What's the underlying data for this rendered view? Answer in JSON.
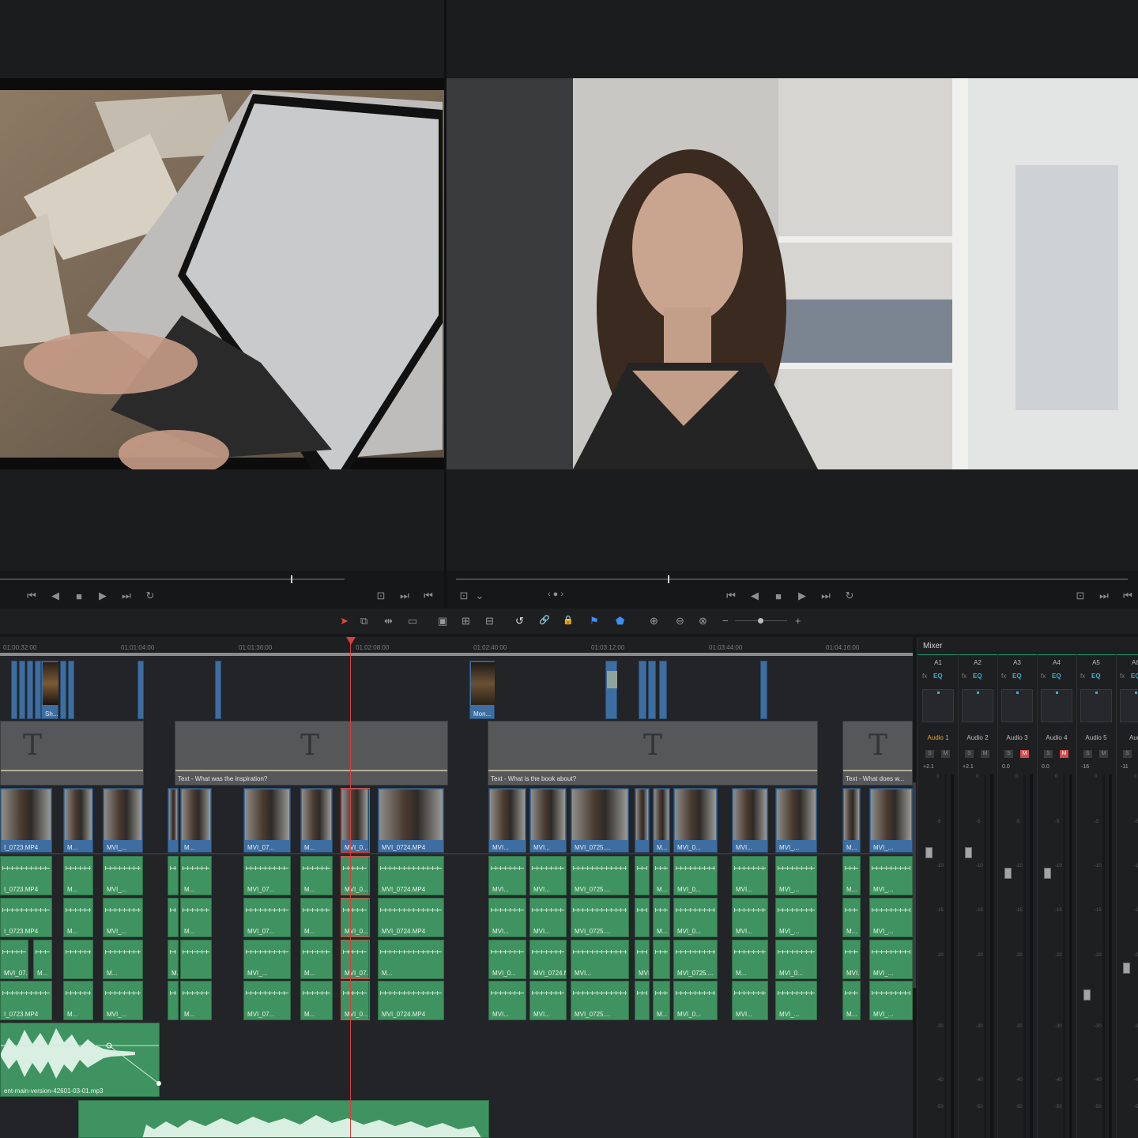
{
  "source_viewer": {
    "scene": "hands typing on laptop beside a book",
    "transport": [
      "⏮",
      "◀",
      "■",
      "▶",
      "⏭",
      "↻"
    ],
    "right_controls": [
      "⊡",
      "⏭",
      "⏮"
    ]
  },
  "timeline_viewer": {
    "scene": "woman with long wavy hair in front of bookshelf",
    "left_controls": [
      "⊡",
      "⌄"
    ],
    "nav": "‹ ● ›",
    "transport": [
      "⏮",
      "◀",
      "■",
      "▶",
      "⏭",
      "↻"
    ],
    "right_controls": [
      "⊡",
      "⏭",
      "⏮"
    ]
  },
  "toolbar": {
    "icons": [
      "selection-arrow",
      "trim",
      "dynamic-trim",
      "blade",
      "insert",
      "overwrite",
      "replace",
      "snapping",
      "linked-selection",
      "lock",
      "flag",
      "marker",
      "zoom-full",
      "zoom-detail",
      "zoom-custom",
      "zoom-out",
      "zoom-in"
    ],
    "glyphs": [
      "➤",
      "⧉",
      "⇹",
      "▭",
      "▣",
      "⊞",
      "⊟",
      "↺",
      "🔗",
      "🔒",
      "⚑",
      "⬟",
      "⊕",
      "⊖",
      "⊗",
      "−",
      "+"
    ]
  },
  "ruler": {
    "timecodes": [
      "01:00:32:00",
      "01:01:04:00",
      "01:01:36:00",
      "01:02:08:00",
      "01:02:40:00",
      "01:03:12:00",
      "01:03:44:00",
      "01:04:16:00"
    ]
  },
  "video_top": {
    "labels": [
      "Sh...",
      "Mon..."
    ]
  },
  "titles": [
    {
      "label": "",
      "glyph": "T"
    },
    {
      "label": "Text - What was the inspiration?",
      "glyph": "T"
    },
    {
      "label": "Text - What is the book about?",
      "glyph": "T"
    },
    {
      "label": "Text - What does w...",
      "glyph": "T"
    }
  ],
  "v1_clips": [
    "I_0723.MP4",
    "M...",
    "MVI_...",
    "M...",
    "MVI_07...",
    "M...",
    "MVI_0...",
    "MVI_0724.MP4",
    "MVI...",
    "MVI...",
    "MVI_0725....",
    "M...",
    "MVI_0...",
    "MVI...",
    "MVI_...",
    "M...",
    "MVI_..."
  ],
  "a1_clips": [
    "I_0723.MP4",
    "M...",
    "MVI_...",
    "M...",
    "MVI_07...",
    "M...",
    "MVI_0...",
    "MVI_0724.MP4",
    "MVI...",
    "MVI...",
    "MVI_0725....",
    "M...",
    "MVI_0...",
    "MVI...",
    "MVI_...",
    "M...",
    "MVI_..."
  ],
  "a2_clips": [
    "I_0723.MP4",
    "M...",
    "MVI_...",
    "M...",
    "MVI_07...",
    "M...",
    "MVI_0...",
    "MVI_0724.MP4",
    "MVI...",
    "MVI...",
    "MVI_0725....",
    "M...",
    "MVI_0...",
    "MVI...",
    "MVI_...",
    "M...",
    "MVI_..."
  ],
  "a3_clips": [
    "MVI_07...",
    "M...",
    "M...",
    "MVI_...",
    "M...",
    "MVI_07...",
    "M...",
    "MVI_0...",
    "MVI_0724.MP4",
    "MVI...",
    "MVI...",
    "MVI_0725....",
    "M...",
    "MVI_0...",
    "MVI...",
    "MVI_...",
    "M...",
    "MVI_..."
  ],
  "a4_clips": [
    "I_0723.MP4",
    "M...",
    "MVI_...",
    "M...",
    "MVI_07...",
    "M...",
    "MVI_0...",
    "MVI_0724.MP4",
    "MVI...",
    "MVI...",
    "MVI_0725....",
    "M...",
    "MVI_0...",
    "MVI...",
    "MVI_...",
    "M...",
    "MVI_..."
  ],
  "music": {
    "label": "ent-main-version-42601-03-01.mp3"
  },
  "mixer": {
    "title": "Mixer",
    "channels": [
      {
        "id": "A1",
        "name": "Audio 1",
        "level": "+2.1",
        "muted": false,
        "active": true
      },
      {
        "id": "A2",
        "name": "Audio 2",
        "level": "+2.1",
        "muted": false,
        "active": false
      },
      {
        "id": "A3",
        "name": "Audio 3",
        "level": "0.0",
        "muted": true,
        "active": false
      },
      {
        "id": "A4",
        "name": "Audio 4",
        "level": "0.0",
        "muted": true,
        "active": false
      },
      {
        "id": "A5",
        "name": "Audio 5",
        "level": "-16",
        "muted": false,
        "active": false
      },
      {
        "id": "A6",
        "name": "Audi",
        "level": "-11",
        "muted": false,
        "active": false
      }
    ],
    "scale": [
      "0",
      "-5",
      "-10",
      "-15",
      "-20",
      "-30",
      "-40",
      "-50"
    ],
    "fx": "fx",
    "eq": "EQ",
    "solo": "S",
    "mute": "M"
  },
  "colors": {
    "video": "#3e6ea1",
    "audio": "#3f9360",
    "playhead": "#d8403a",
    "eq": "#3bb0d6"
  }
}
